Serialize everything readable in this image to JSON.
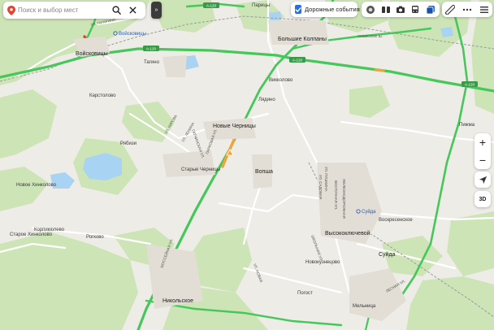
{
  "search": {
    "placeholder": "Поиск и выбор мест"
  },
  "toolbar": {
    "collapse_glyph": "»",
    "traffic_label": "Дорожные события",
    "traffic_checked": true,
    "layer_icons": [
      "panorama-icon",
      "transit-icon",
      "camera-icon",
      "bus-icon",
      "layers-icon"
    ],
    "tool_icons": [
      "ruler-icon",
      "more-icon",
      "menu-icon"
    ]
  },
  "controls": {
    "zoom_in": "+",
    "zoom_out": "−",
    "mode_3d": "3D"
  },
  "map": {
    "towns": {
      "voyskovitsy": "Войсковицы",
      "bolshie_kolpany": "Большие Колпаны",
      "novye_chernitsy": "Новые Черницы",
      "vopsha": "Вопша",
      "vysokoklyuchevoy": "Высокоключевой",
      "nikolskoe": "Никольское",
      "siuda": "Суйда"
    },
    "villages": {
      "tagino": "Тагино",
      "karstolovo": "Карстолово",
      "vikkolovo": "Викколово",
      "lyadino": "Лядино",
      "ryabizi": "Рябизи",
      "starye_chernitsy": "Старые Черницы",
      "novoe_khinkolovo": "Новое Хинколово",
      "korpikyulevo": "Корпикюлево",
      "staroe_khinkolovo": "Старое Хинколово",
      "rogkovo": "Рогково",
      "pizhma": "Пижма",
      "voskresenskoe": "Воскресенское",
      "novokuzhdevo": "Новокузнецово",
      "pogost": "Погост",
      "melnitsa": "Мельница",
      "paritsy": "Парицы"
    },
    "stations": {
      "voyskovitsy": "Войсковицы",
      "siuda": "Суйда"
    },
    "road_numbers": {
      "a120_a": "А-120",
      "a120_b": "А-120",
      "a120_c": "А-120",
      "a120_d": "А-120"
    },
    "streets": {
      "khievskoe": "ХИЕВСКОЕ Ш.",
      "gagarina": "УЛ. ГАГАРИНА",
      "gatchinskaya": "ГАТЧИНСКАЯ УЛ.",
      "kirova": "УЛ. КИРОВА",
      "lenina": "УЛ. ЛЕНИНА",
      "parkovaya": "ПАРКОВАЯ УЛ.",
      "zheleznodorozhnaya": "ЖЕЛЕЗНОДОРОЖНАЯ",
      "vostochnaya": "ВОСТОЧНАЯ УЛ.",
      "pushkina": "УЛ. ПУШКИНА",
      "sadovaya": "УЛ. САДОВАЯ",
      "shkolnaya": "ШКОЛЬНАЯ УЛ.",
      "novaya": "УЛ. НОВАЯ",
      "shosseynaya": "ШОССЕЙНАЯ УЛ.",
      "lesnaya": "ЛЕСНАЯ УЛ."
    }
  },
  "colors": {
    "forest": "#cde4b6",
    "field": "#eeece6",
    "water": "#a9d3f2",
    "road_traffic_free": "#46c75a",
    "road_traffic_slow": "#f2a33a",
    "road_traffic_jam": "#d9453b",
    "accent": "#2d6ce0",
    "pin": "#e5432f"
  }
}
